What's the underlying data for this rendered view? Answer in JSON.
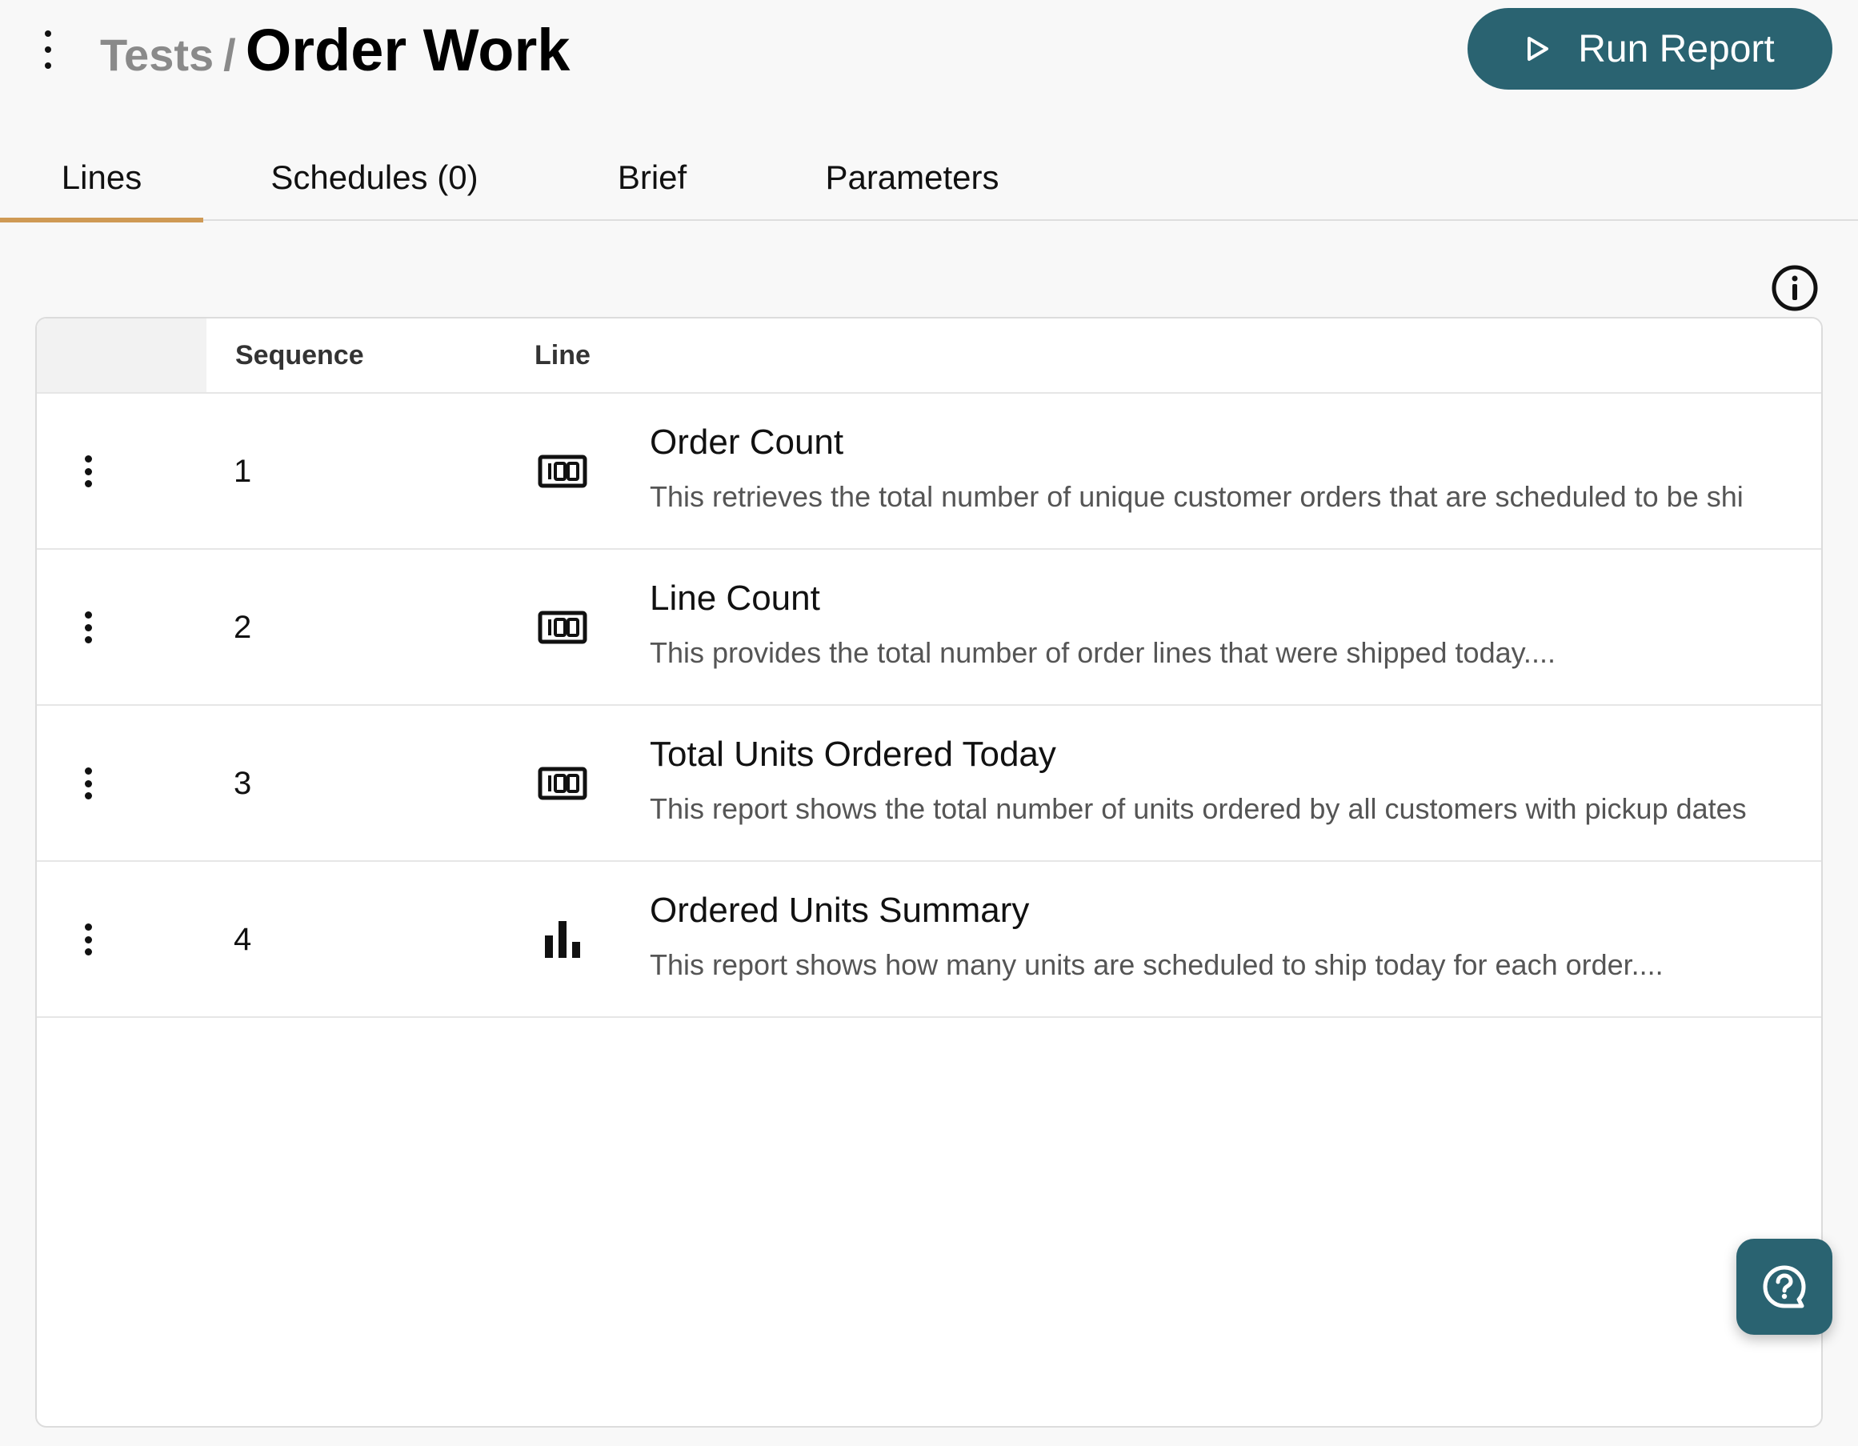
{
  "header": {
    "breadcrumb_parent": "Tests",
    "breadcrumb_separator": "/",
    "title": "Order Work",
    "run_button_label": "Run Report"
  },
  "tabs": [
    {
      "label": "Lines",
      "active": true
    },
    {
      "label": "Schedules (0)",
      "active": false
    },
    {
      "label": "Brief",
      "active": false
    },
    {
      "label": "Parameters",
      "active": false
    }
  ],
  "table": {
    "columns": {
      "sequence": "Sequence",
      "line": "Line"
    },
    "rows": [
      {
        "sequence": "1",
        "icon": "number-tile-icon",
        "title": "Order Count",
        "description": "This retrieves the total number of unique customer orders that are scheduled to be shi"
      },
      {
        "sequence": "2",
        "icon": "number-tile-icon",
        "title": "Line Count",
        "description": "This provides the total number of order lines that were shipped today...."
      },
      {
        "sequence": "3",
        "icon": "number-tile-icon",
        "title": "Total Units Ordered Today",
        "description": "This report shows the total number of units ordered by all customers with pickup dates"
      },
      {
        "sequence": "4",
        "icon": "bar-chart-icon",
        "title": "Ordered Units Summary",
        "description": "This report shows how many units are scheduled to ship today for each order...."
      }
    ]
  },
  "icons": {
    "menu": "vertical-dots-icon",
    "run": "play-icon",
    "info": "info-icon",
    "help": "help-chat-icon"
  },
  "colors": {
    "primary": "#2a6371",
    "tab_indicator": "#cf9a55",
    "background": "#f8f8f8"
  }
}
